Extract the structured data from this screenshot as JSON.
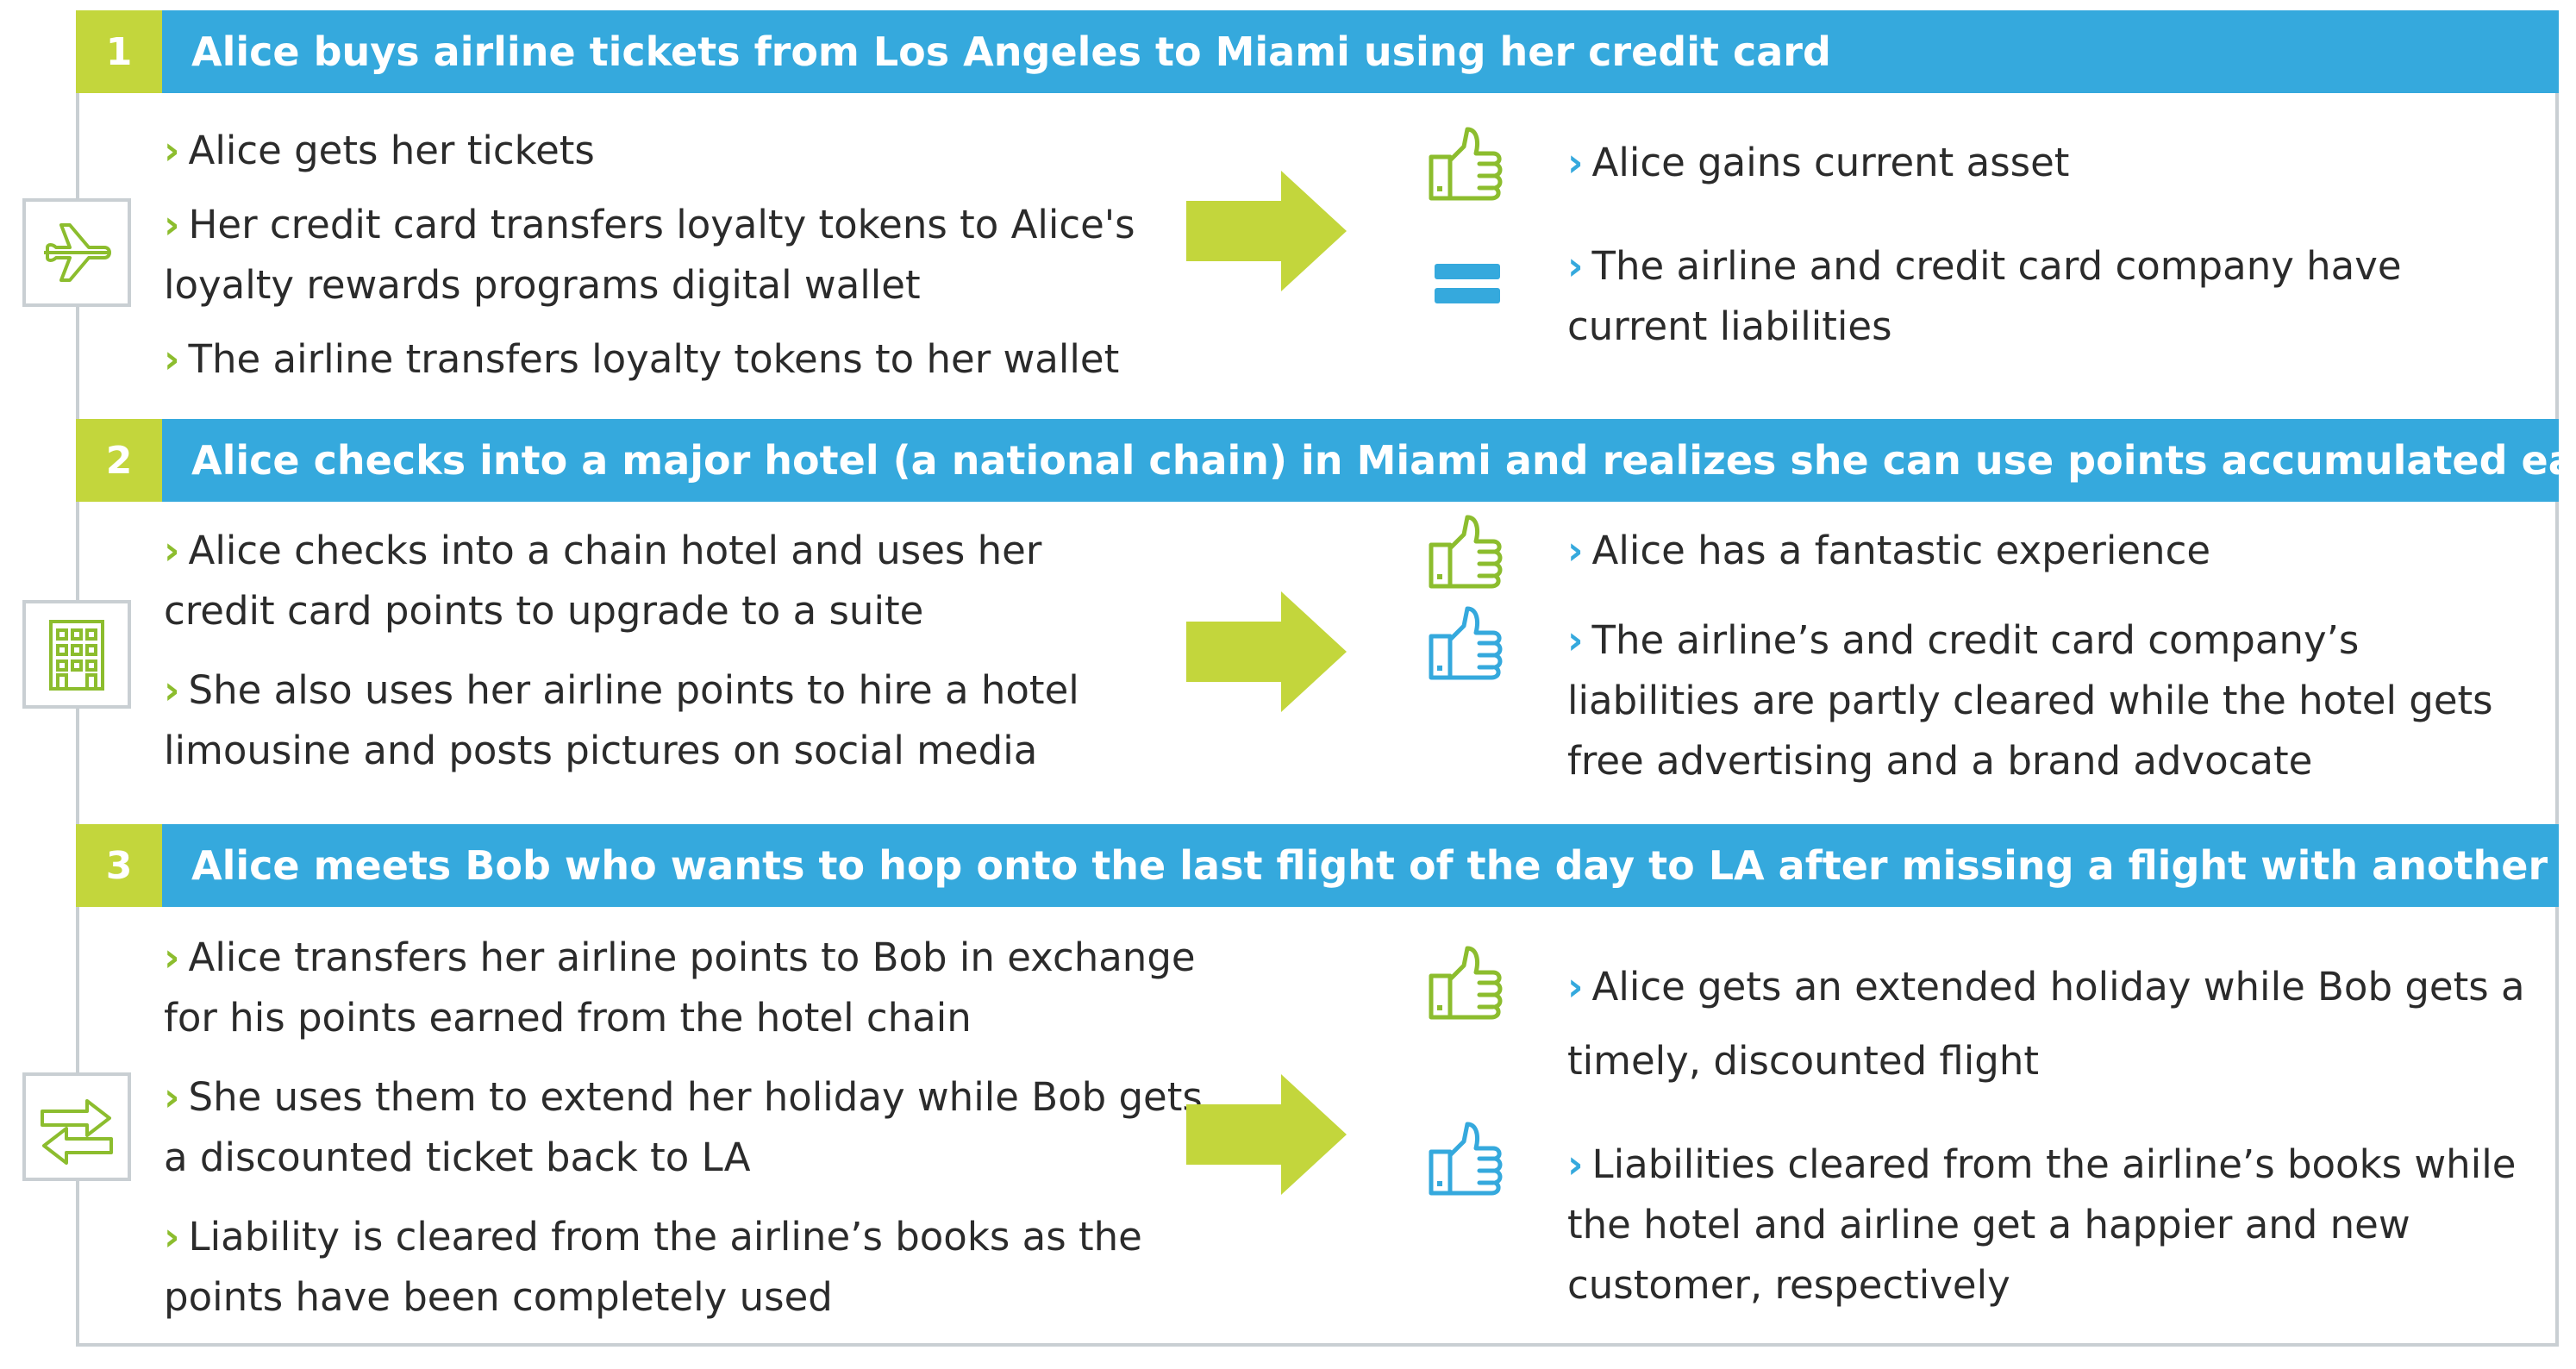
{
  "steps": [
    {
      "number": "1",
      "title": "Alice buys airline tickets from Los Angeles to Miami using her credit card",
      "left_icon": "airplane-icon",
      "bullets": [
        "Alice gets her tickets",
        "Her credit card transfers loyalty tokens to Alice's loyalty rewards programs digital wallet",
        "The airline transfers loyalty tokens to her wallet"
      ],
      "results": [
        {
          "icon": "thumbs-up-green-icon",
          "text": "Alice gains current asset"
        },
        {
          "icon": "equals-icon",
          "text": "The airline and credit card company have current liabilities"
        }
      ]
    },
    {
      "number": "2",
      "title": "Alice checks into a major hotel (a national chain) in Miami and realizes she can use points accumulated earlier",
      "left_icon": "hotel-building-icon",
      "bullets": [
        "Alice checks into a chain hotel and uses her credit card points to upgrade to a suite",
        "She also uses her airline points to hire a hotel limousine and posts pictures on social media"
      ],
      "results": [
        {
          "icon": "thumbs-up-green-icon",
          "text": "Alice has a fantastic experience"
        },
        {
          "icon": "thumbs-up-blue-icon",
          "text": "The airline’s and credit card company’s liabilities are partly cleared while the hotel gets free advertising and a brand advocate"
        }
      ]
    },
    {
      "number": "3",
      "title": "Alice meets Bob who wants to hop onto the last flight of the day to LA after missing a flight with another airline",
      "left_icon": "exchange-arrows-icon",
      "bullets": [
        "Alice transfers her airline points to Bob in exchange for his points earned from the hotel chain",
        "She uses them to extend her holiday while Bob gets a discounted ticket back to LA",
        "Liability is cleared from the airline’s books as the points have been completely used"
      ],
      "results": [
        {
          "icon": "thumbs-up-green-icon",
          "text": "Alice gets an extended holiday while Bob gets a timely, discounted flight"
        },
        {
          "icon": "thumbs-up-blue-icon",
          "text": "Liabilities cleared from the airline’s books while the hotel and airline get a happier and new customer, respectively"
        }
      ]
    }
  ],
  "bullet_marker": "›",
  "colors": {
    "header_blue": "#35a9dd",
    "number_green": "#c3d63c",
    "arrow_green": "#c3d63c",
    "icon_green": "#8cbd2e",
    "border_gray": "#c9cfd3"
  }
}
